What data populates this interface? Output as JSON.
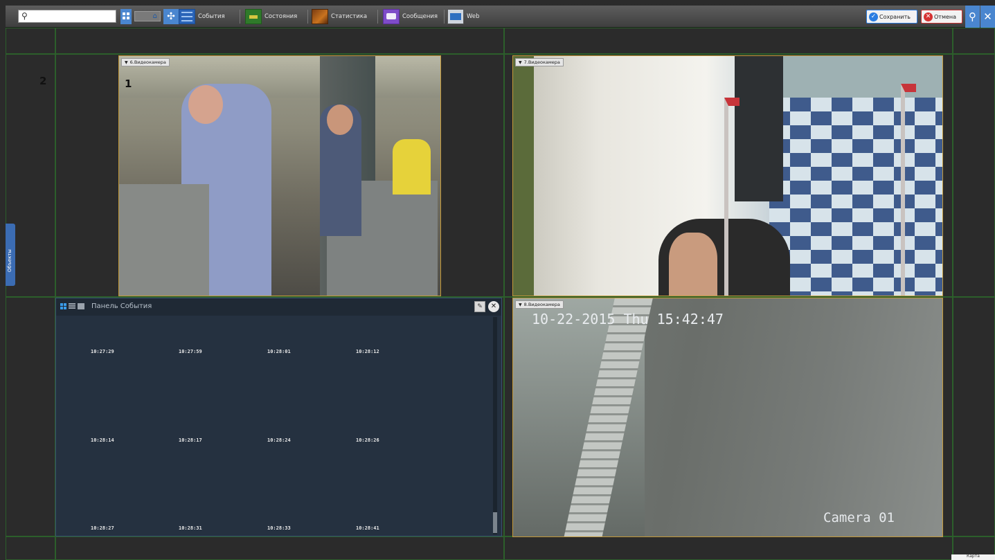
{
  "toolbar": {
    "search_placeholder": "",
    "tabs": [
      {
        "label": "События",
        "icon": "events-clock-icon"
      },
      {
        "label": "Состояния",
        "icon": "states-icon"
      },
      {
        "label": "Статистика",
        "icon": "statistics-icon"
      },
      {
        "label": "Сообщения",
        "icon": "messages-icon"
      },
      {
        "label": "Web",
        "icon": "web-icon"
      }
    ],
    "save_label": "Сохранить",
    "cancel_label": "Отмена"
  },
  "sidebar": {
    "objects_label": "Объекты"
  },
  "annotations": {
    "one": "1",
    "two": "2"
  },
  "cameras": [
    {
      "name": "6.Видеокамера"
    },
    {
      "name": "7.Видеокамера"
    },
    {
      "name": "8.Видеокамера",
      "overlay_time": "10-22-2015 Thu 15:42:47",
      "overlay_label": "Camera 01"
    }
  ],
  "events_panel": {
    "title": "Панель События",
    "times": [
      [
        "10:27:29",
        "10:27:59",
        "10:28:01",
        "10:28:12"
      ],
      [
        "10:28:14",
        "10:28:17",
        "10:28:24",
        "10:28:26"
      ],
      [
        "10:28:27",
        "10:28:31",
        "10:28:33",
        "10:28:41"
      ]
    ]
  },
  "map_tab": {
    "label": "Карта"
  },
  "colors": {
    "accent": "#4a86cf",
    "grid_border": "#2c5f2b",
    "camera_border": "#c49a3a",
    "panel_bg": "#253140"
  }
}
